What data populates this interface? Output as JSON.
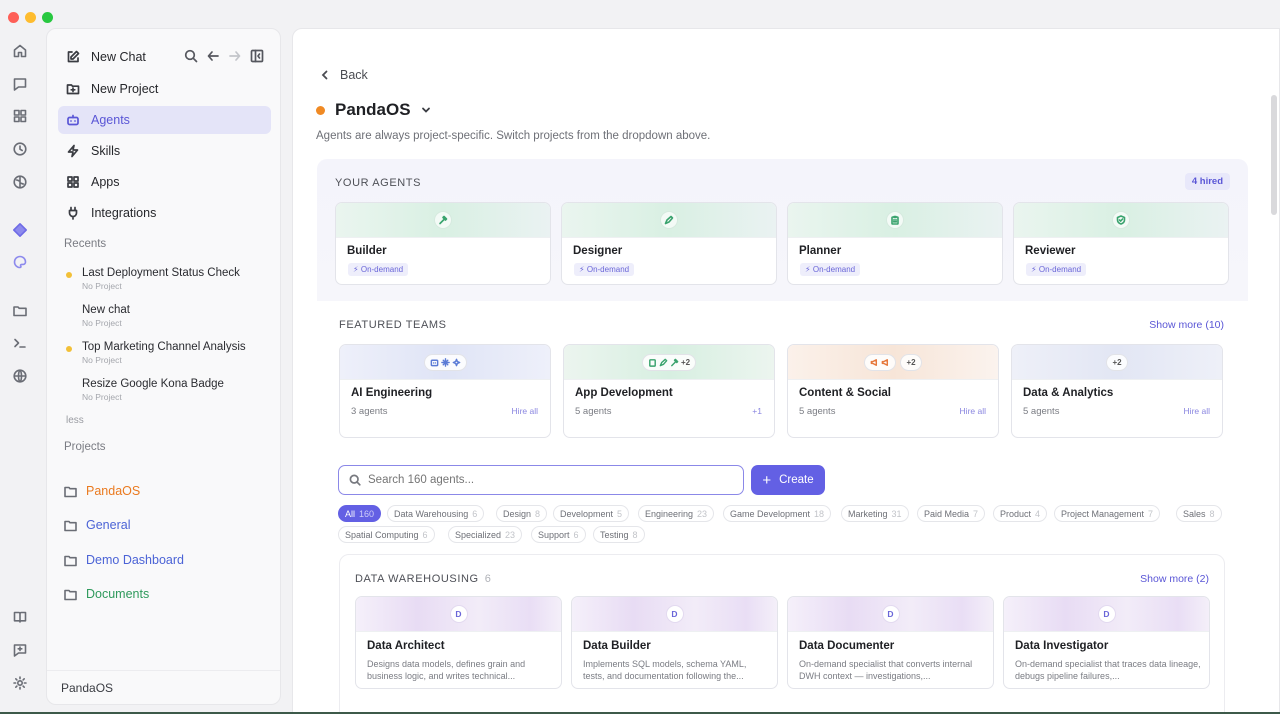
{
  "sidebar": {
    "new_chat": "New Chat",
    "new_project": "New Project",
    "agents": "Agents",
    "skills": "Skills",
    "apps": "Apps",
    "integrations": "Integrations",
    "recents_label": "Recents",
    "recents": [
      {
        "title": "Last Deployment Status Check",
        "sub": "No Project"
      },
      {
        "title": "New chat",
        "sub": "No Project"
      },
      {
        "title": "Top Marketing Channel Analysis",
        "sub": "No Project"
      },
      {
        "title": "Resize Google Kona Badge",
        "sub": "No Project"
      }
    ],
    "less": "less",
    "projects_label": "Projects",
    "projects": [
      {
        "name": "PandaOS",
        "color": "#ea7a1f"
      },
      {
        "name": "General",
        "color": "#4b63d6"
      },
      {
        "name": "Demo Dashboard",
        "color": "#4b63d6"
      },
      {
        "name": "Documents",
        "color": "#2f9a5c"
      }
    ],
    "footer": "PandaOS"
  },
  "main": {
    "back": "Back",
    "project_title": "PandaOS",
    "subtitle": "Agents are always project-specific. Switch projects from the dropdown above.",
    "your_agents_label": "YOUR AGENTS",
    "hired_badge": "4 hired",
    "agents": [
      {
        "name": "Builder",
        "tag": "On-demand",
        "icon": "hammer-icon"
      },
      {
        "name": "Designer",
        "tag": "On-demand",
        "icon": "pen-icon"
      },
      {
        "name": "Planner",
        "tag": "On-demand",
        "icon": "clipboard-icon"
      },
      {
        "name": "Reviewer",
        "tag": "On-demand",
        "icon": "shield-check-icon"
      }
    ],
    "featured_label": "FEATURED TEAMS",
    "featured_show_more": "Show more (10)",
    "teams": [
      {
        "name": "AI Engineering",
        "count": "3 agents",
        "action": "Hire all",
        "extra": ""
      },
      {
        "name": "App Development",
        "count": "5 agents",
        "action": "+1",
        "extra": "+2"
      },
      {
        "name": "Content & Social",
        "count": "5 agents",
        "action": "Hire all",
        "extra": "+2"
      },
      {
        "name": "Data & Analytics",
        "count": "5 agents",
        "action": "Hire all",
        "extra": "+2"
      }
    ],
    "search_placeholder": "Search 160 agents...",
    "create": "Create",
    "chips": [
      {
        "label": "All",
        "count": "160"
      },
      {
        "label": "Data Warehousing",
        "count": "6"
      },
      {
        "label": "Design",
        "count": "8"
      },
      {
        "label": "Development",
        "count": "5"
      },
      {
        "label": "Engineering",
        "count": "23"
      },
      {
        "label": "Game Development",
        "count": "18"
      },
      {
        "label": "Marketing",
        "count": "31"
      },
      {
        "label": "Paid Media",
        "count": "7"
      },
      {
        "label": "Product",
        "count": "4"
      },
      {
        "label": "Project Management",
        "count": "7"
      },
      {
        "label": "Sales",
        "count": "8"
      },
      {
        "label": "Spatial Computing",
        "count": "6"
      },
      {
        "label": "Specialized",
        "count": "23"
      },
      {
        "label": "Support",
        "count": "6"
      },
      {
        "label": "Testing",
        "count": "8"
      }
    ],
    "dw_label": "DATA WAREHOUSING",
    "dw_count": "6",
    "dw_show_more": "Show more (2)",
    "dw_agents": [
      {
        "initial": "D",
        "name": "Data Architect",
        "desc": "Designs data models, defines grain and business logic, and writes technical..."
      },
      {
        "initial": "D",
        "name": "Data Builder",
        "desc": "Implements SQL models, schema YAML, tests, and documentation following the..."
      },
      {
        "initial": "D",
        "name": "Data Documenter",
        "desc": "On-demand specialist that converts internal DWH context — investigations,..."
      },
      {
        "initial": "D",
        "name": "Data Investigator",
        "desc": "On-demand specialist that traces data lineage, debugs pipeline failures,..."
      }
    ]
  },
  "colors": {
    "accent": "#6360e4",
    "active_bg": "#e4e4f8",
    "project_dot": "#f08a24"
  }
}
